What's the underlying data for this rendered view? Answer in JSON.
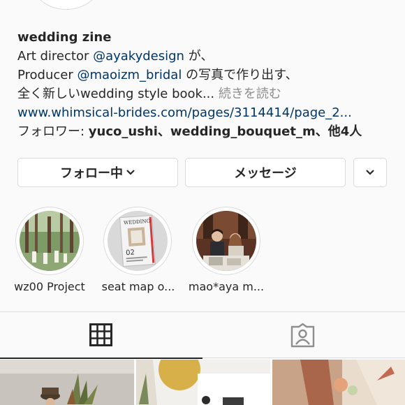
{
  "profile": {
    "name": "wedding zine",
    "bio": {
      "line1_prefix": "Art director ",
      "line1_mention": "@ayakydesign",
      "line1_suffix": " が、",
      "line2_prefix": "Producer ",
      "line2_mention": "@maoizm_bridal",
      "line2_suffix": " の写真で作り出す、",
      "line3_text": "全く新しいwedding  style book...",
      "line3_more": " 続きを読む",
      "link": "www.whimsical-brides.com/pages/3114414/page_2...",
      "followers_prefix": "フォロワー: ",
      "followers_names": "yuco_ushi、wedding_bouquet_m、他4人"
    }
  },
  "buttons": {
    "follow": "フォロー中",
    "message": "メッセージ"
  },
  "highlights": [
    {
      "label": "wz00 Project"
    },
    {
      "label": "seat map o..."
    },
    {
      "label": "mao*aya m..."
    }
  ],
  "tabs": {
    "active": "grid"
  },
  "highlight_cover": {
    "magazine_title": "WEDDING",
    "magazine_number": "02"
  }
}
